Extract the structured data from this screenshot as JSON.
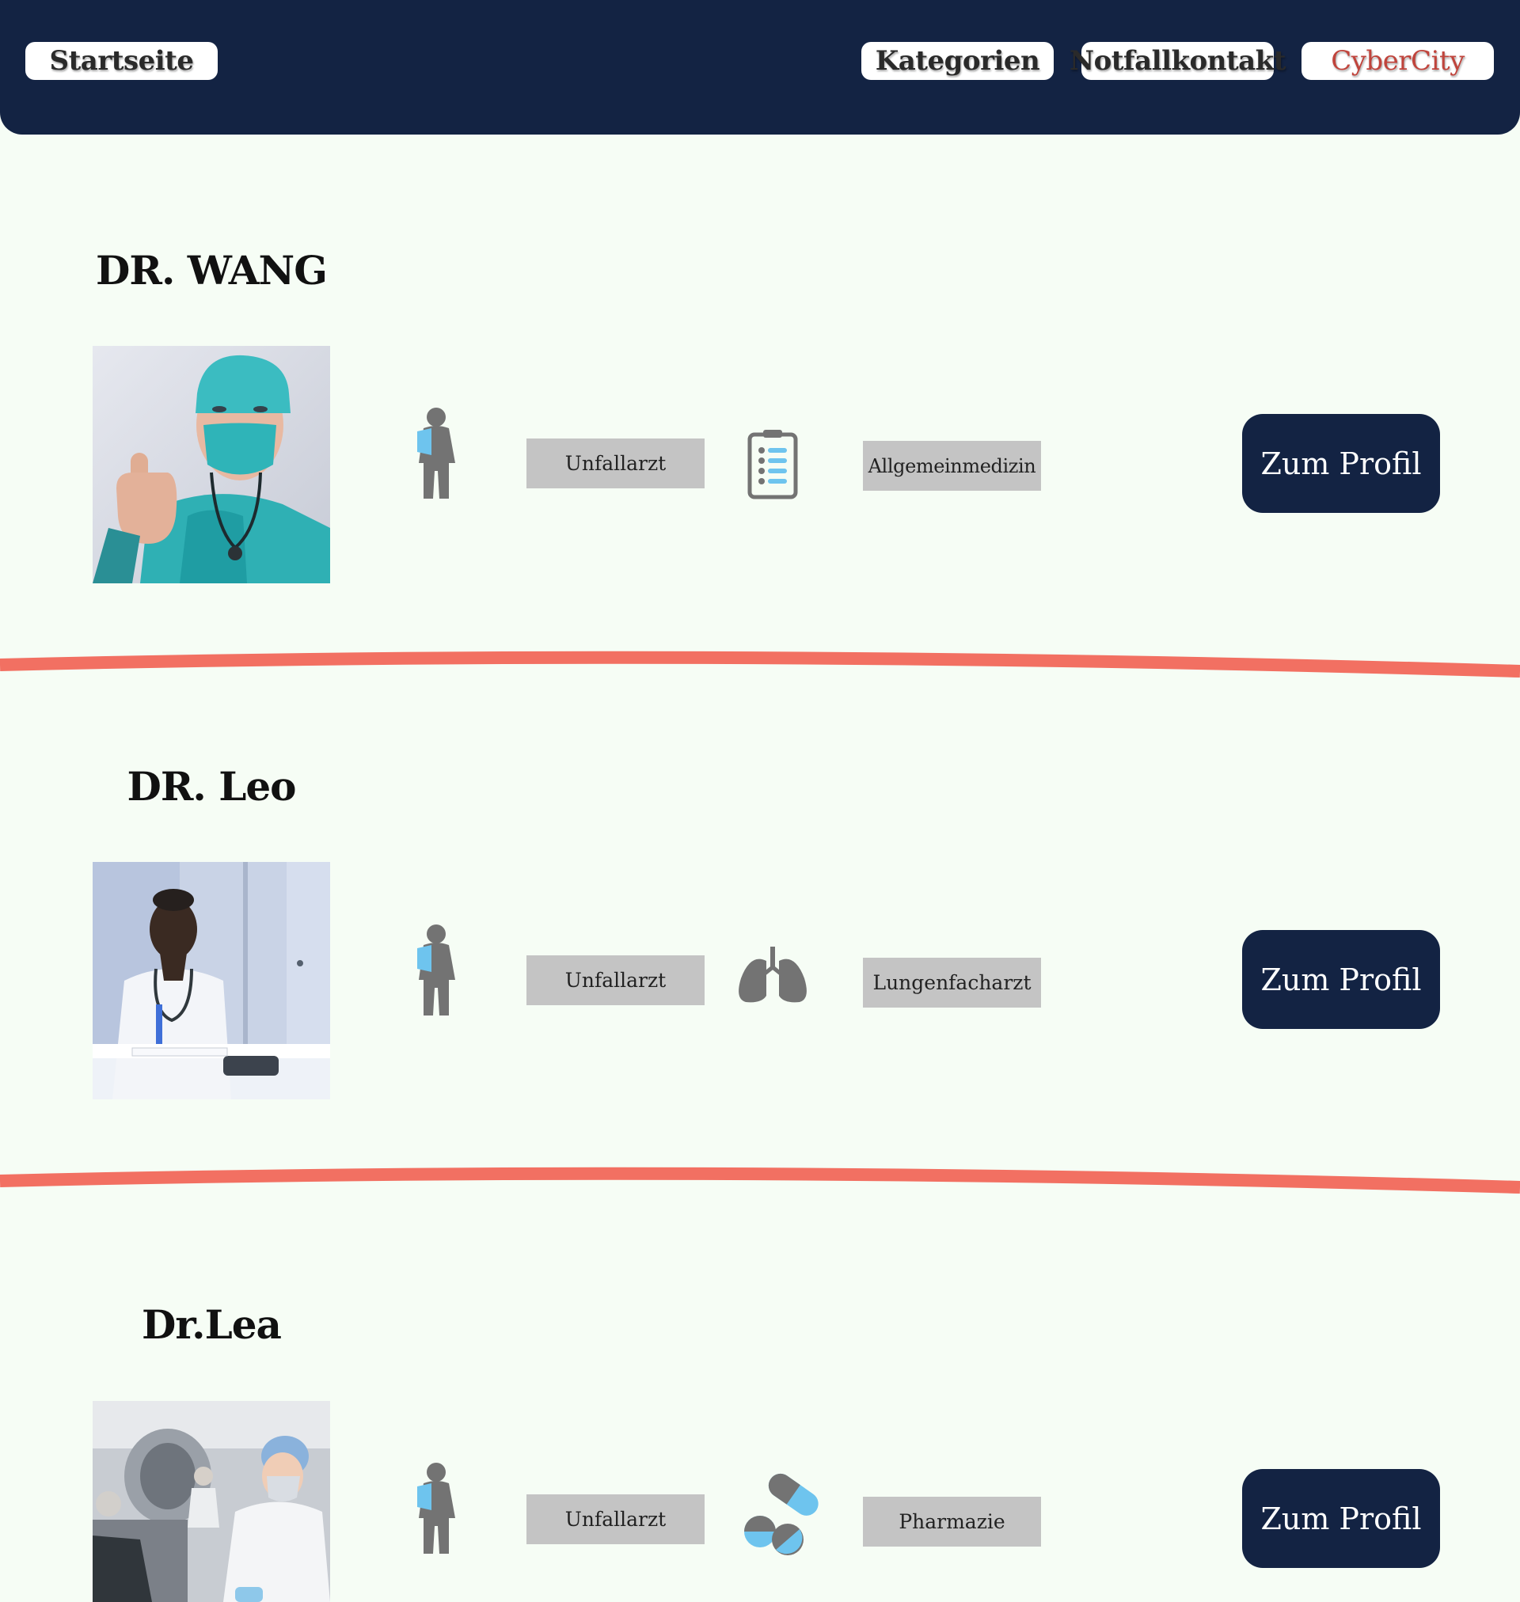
{
  "nav": {
    "home": "Startseite",
    "categories": "Kategorien",
    "emergency": "Notfallkontakt",
    "brand": "CyberCity"
  },
  "doctors": [
    {
      "name": "DR. WANG",
      "tag1": "Unfallarzt",
      "tag2": "Allgemeinmedizin",
      "specialty_icon": "clipboard-icon",
      "cta": "Zum Profil"
    },
    {
      "name": "DR. Leo",
      "tag1": "Unfallarzt",
      "tag2": "Lungenfacharzt",
      "specialty_icon": "lungs-icon",
      "cta": "Zum Profil"
    },
    {
      "name": "Dr.Lea",
      "tag1": "Unfallarzt",
      "tag2": "Pharmazie",
      "specialty_icon": "pills-icon",
      "cta": "Zum Profil"
    }
  ],
  "colors": {
    "navy": "#132343",
    "background": "#f6fdf5",
    "divider": "#f27062",
    "tag": "#c4c4c4",
    "icon_gray": "#737373",
    "icon_blue": "#6ec4ee",
    "brand_red": "#c0443c"
  }
}
